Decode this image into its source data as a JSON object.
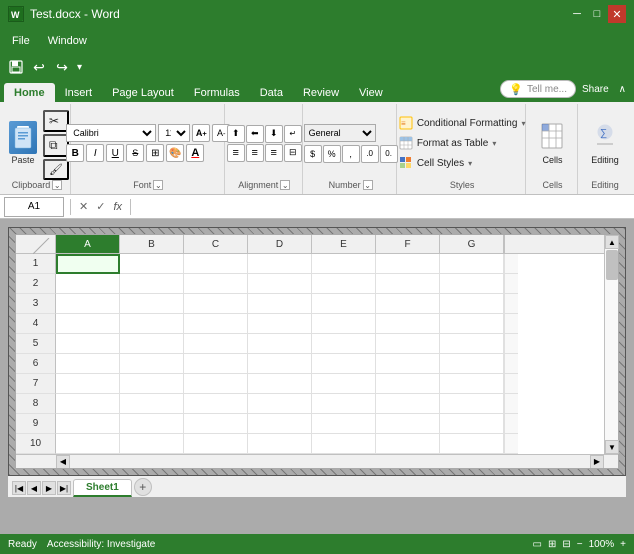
{
  "window": {
    "title": "Test.docx - Word",
    "icon": "X"
  },
  "titlebar": {
    "title": "Test.docx - Word",
    "minimize": "─",
    "maximize": "□",
    "close": "✕"
  },
  "menubar": {
    "items": [
      "File",
      "Window"
    ]
  },
  "quickaccess": {
    "save": "💾",
    "undo": "↩",
    "redo": "↪",
    "customize": "▾"
  },
  "ribbon": {
    "tabs": [
      "Home",
      "Insert",
      "Page Layout",
      "Formulas",
      "Data",
      "Review",
      "View"
    ],
    "active_tab": "Home",
    "tell_me": "Tell me...",
    "share": "Share",
    "groups": {
      "clipboard": {
        "label": "Clipboard",
        "paste_label": "Paste",
        "cut": "✂",
        "copy": "⧉",
        "format_painter": "🖌"
      },
      "font": {
        "label": "Font",
        "font_name": "Calibri",
        "font_size": "11",
        "bold": "B",
        "italic": "I",
        "underline": "U",
        "strikethrough": "S",
        "increase_font": "A↑",
        "decrease_font": "A↓",
        "font_color": "A",
        "fill_color": "🎨",
        "borders": "⊞",
        "expand_icon": "⌄"
      },
      "alignment": {
        "label": "Alignment",
        "align_left": "≡",
        "align_center": "≡",
        "align_right": "≡",
        "top_align": "⊤",
        "mid_align": "≡",
        "bot_align": "⊥",
        "wrap_text": "⌐",
        "merge": "⊟",
        "indent_dec": "←",
        "indent_inc": "→",
        "expand_icon": "⌄"
      },
      "number": {
        "label": "Number",
        "format": "%",
        "expand_icon": "⌄"
      },
      "styles": {
        "label": "Styles",
        "conditional_formatting": "Conditional Formatting",
        "format_table": "Format as Table",
        "cell_styles": "Cell Styles",
        "dropdown": "▾"
      },
      "cells": {
        "label": "Cells",
        "label_text": "Cells"
      },
      "editing": {
        "label": "Editing",
        "label_text": "Editing"
      }
    }
  },
  "formulabar": {
    "cell_ref": "A1",
    "cancel": "✕",
    "confirm": "✓",
    "fx": "fx",
    "value": ""
  },
  "spreadsheet": {
    "columns": [
      "A",
      "B",
      "C",
      "D",
      "E",
      "F",
      "G"
    ],
    "rows": [
      1,
      2,
      3,
      4,
      5,
      6,
      7,
      8,
      9,
      10
    ],
    "selected_cell": "A1"
  },
  "sheets": {
    "tabs": [
      "Sheet1"
    ],
    "active": "Sheet1"
  },
  "statusbar": {
    "ready": "Ready",
    "accessibility": "Accessibility: Investigate"
  }
}
